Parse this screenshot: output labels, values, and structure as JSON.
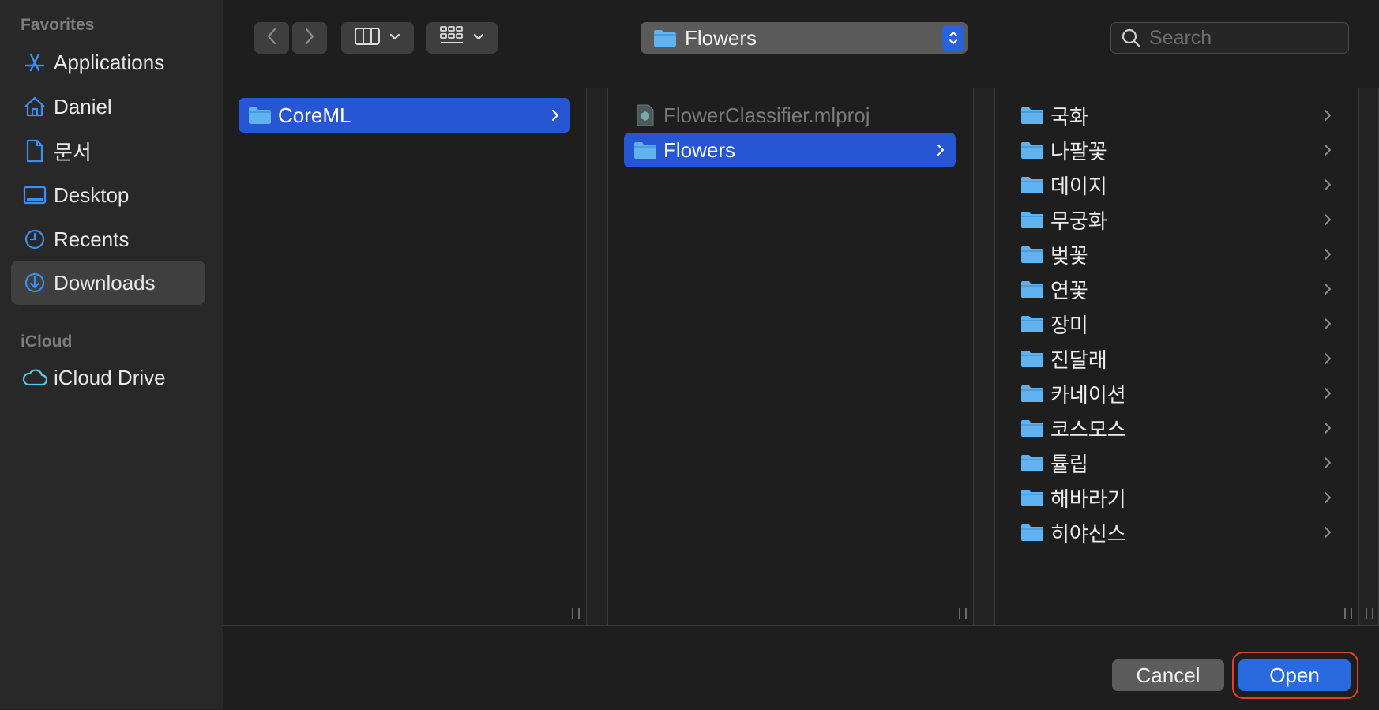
{
  "sidebar": {
    "favorites_header": "Favorites",
    "icloud_header": "iCloud",
    "items": [
      {
        "label": "Applications",
        "icon": "applications-icon"
      },
      {
        "label": "Daniel",
        "icon": "home-icon"
      },
      {
        "label": "문서",
        "icon": "document-icon"
      },
      {
        "label": "Desktop",
        "icon": "desktop-icon"
      },
      {
        "label": "Recents",
        "icon": "clock-icon"
      },
      {
        "label": "Downloads",
        "icon": "download-icon",
        "selected": true
      }
    ],
    "icloud_items": [
      {
        "label": "iCloud Drive",
        "icon": "cloud-icon"
      }
    ]
  },
  "toolbar": {
    "path_label": "Flowers",
    "search_placeholder": "Search"
  },
  "columns": [
    {
      "items": [
        {
          "label": "CoreML",
          "type": "folder",
          "selected": true
        }
      ]
    },
    {
      "items": [
        {
          "label": "FlowerClassifier.mlproj",
          "type": "file",
          "dimmed": true
        },
        {
          "label": "Flowers",
          "type": "folder",
          "selected": true
        }
      ]
    },
    {
      "items": [
        {
          "label": "국화",
          "type": "folder"
        },
        {
          "label": "나팔꽃",
          "type": "folder"
        },
        {
          "label": "데이지",
          "type": "folder"
        },
        {
          "label": "무궁화",
          "type": "folder"
        },
        {
          "label": "벚꽃",
          "type": "folder"
        },
        {
          "label": "연꽃",
          "type": "folder"
        },
        {
          "label": "장미",
          "type": "folder"
        },
        {
          "label": "진달래",
          "type": "folder"
        },
        {
          "label": "카네이션",
          "type": "folder"
        },
        {
          "label": "코스모스",
          "type": "folder"
        },
        {
          "label": "튤립",
          "type": "folder"
        },
        {
          "label": "해바라기",
          "type": "folder"
        },
        {
          "label": "히야신스",
          "type": "folder"
        }
      ]
    }
  ],
  "footer": {
    "cancel_label": "Cancel",
    "open_label": "Open"
  },
  "colors": {
    "accent": "#2656d4",
    "sidebar_icon": "#3b8ff0",
    "folder": "#5fb3f0",
    "highlight_ring": "#e0402a"
  }
}
